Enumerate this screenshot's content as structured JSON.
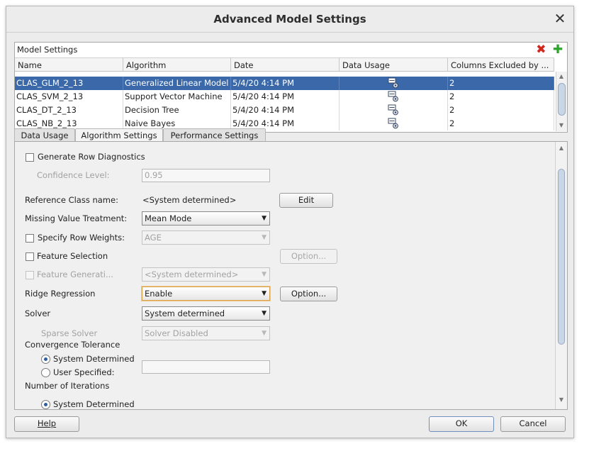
{
  "window": {
    "title": "Advanced Model Settings",
    "close_glyph": "✕"
  },
  "model_settings": {
    "title": "Model Settings",
    "delete_icon": "delete-icon",
    "add_icon": "add-icon",
    "columns": [
      "Name",
      "Algorithm",
      "Date",
      "Data Usage",
      "Columns Excluded by ..."
    ],
    "rows": [
      {
        "name": "CLAS_GLM_2_13",
        "algorithm": "Generalized Linear Model",
        "date": "5/4/20 4:14 PM",
        "data_usage_icon": "data-usage-icon",
        "excluded": "2",
        "selected": true
      },
      {
        "name": "CLAS_SVM_2_13",
        "algorithm": "Support Vector Machine",
        "date": "5/4/20 4:14 PM",
        "data_usage_icon": "data-usage-icon",
        "excluded": "2",
        "selected": false
      },
      {
        "name": "CLAS_DT_2_13",
        "algorithm": "Decision Tree",
        "date": "5/4/20 4:14 PM",
        "data_usage_icon": "data-usage-icon",
        "excluded": "2",
        "selected": false
      },
      {
        "name": "CLAS_NB_2_13",
        "algorithm": "Naive Bayes",
        "date": "5/4/20 4:14 PM",
        "data_usage_icon": "data-usage-icon",
        "excluded": "2",
        "selected": false
      }
    ]
  },
  "tabs": [
    {
      "label": "Data Usage",
      "active": false
    },
    {
      "label": "Algorithm Settings",
      "active": true
    },
    {
      "label": "Performance Settings",
      "active": false
    }
  ],
  "algorithm_settings": {
    "generate_row_diagnostics": {
      "label": "Generate Row Diagnostics",
      "checked": false
    },
    "confidence_level": {
      "label": "Confidence Level:",
      "value": "0.95"
    },
    "reference_class": {
      "label": "Reference Class name:",
      "value": "<System determined>",
      "button": "Edit"
    },
    "missing_value": {
      "label": "Missing Value Treatment:",
      "value": "Mean Mode"
    },
    "row_weights": {
      "label": "Specify Row Weights:",
      "value": "AGE",
      "checked": false
    },
    "feature_selection": {
      "label": "Feature Selection",
      "checked": false,
      "button": "Option..."
    },
    "feature_generation": {
      "label": "Feature Generati...",
      "value": "<System determined>",
      "checked": false
    },
    "ridge_regression": {
      "label": "Ridge Regression",
      "value": "Enable",
      "button": "Option..."
    },
    "solver": {
      "label": "Solver",
      "value": "System determined"
    },
    "sparse_solver": {
      "label": "Sparse Solver",
      "value": "Solver Disabled"
    },
    "convergence_tolerance": {
      "label": "Convergence Tolerance",
      "options": [
        "System Determined",
        "User Specified:"
      ],
      "selected": "System Determined",
      "value": ""
    },
    "iterations": {
      "label": "Number of Iterations",
      "options": [
        "System Determined"
      ],
      "selected": "System Determined"
    }
  },
  "footer": {
    "help": "Help",
    "ok": "OK",
    "cancel": "Cancel"
  }
}
